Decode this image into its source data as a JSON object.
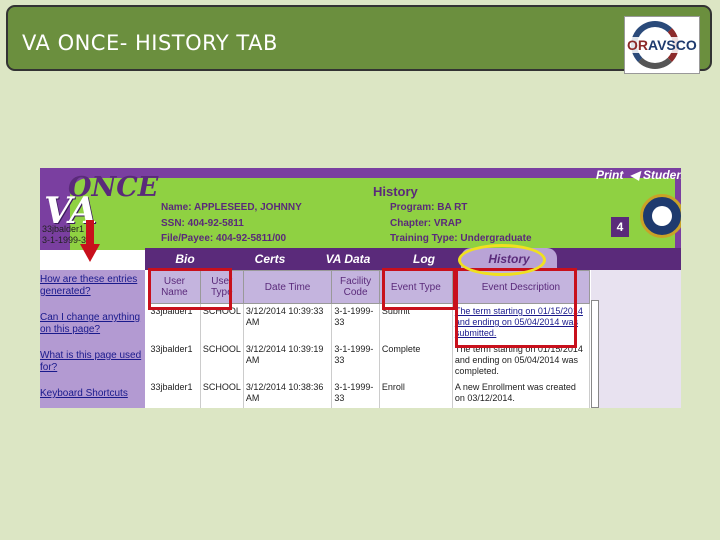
{
  "slide": {
    "title": "VA ONCE- HISTORY TAB"
  },
  "logo": {
    "or": "OR",
    "rest": "AVSCO"
  },
  "app": {
    "logo_once": "ONCE",
    "logo_va": "VA",
    "topnav": [
      "Print",
      "Studen"
    ],
    "page_title": "History",
    "name": "Name: APPLESEED, JOHNNY",
    "ssn": "SSN: 404-92-5811",
    "file": "File/Payee: 404-92-5811/00",
    "program": "Program: BA RT",
    "chapter": "Chapter: VRAP",
    "training": "Training Type: Undergraduate",
    "badge": "4",
    "user_lines": [
      "33jbalder1",
      "3-1-1999-3"
    ]
  },
  "tabs": [
    "Bio",
    "Certs",
    "VA Data",
    "Log",
    "History"
  ],
  "sidebar": {
    "links": [
      "How are these entries generated?",
      "Can I change anything on this page?",
      "What is this page used for?",
      "Keyboard Shortcuts"
    ]
  },
  "table": {
    "headers": [
      "User Name",
      "User Type",
      "Date Time",
      "Facility Code",
      "Event Type",
      "Event Description"
    ],
    "rows": [
      [
        "33jbalder1",
        "SCHOOL",
        "3/12/2014 10:39:33 AM",
        "3-1-1999-33",
        "Submit",
        "The term starting on 01/15/2014 and ending on 05/04/2014 was submitted."
      ],
      [
        "33jbalder1",
        "SCHOOL",
        "3/12/2014 10:39:19 AM",
        "3-1-1999-33",
        "Complete",
        "The term starting on 01/15/2014 and ending on 05/04/2014 was completed."
      ],
      [
        "33jbalder1",
        "SCHOOL",
        "3/12/2014 10:38:36 AM",
        "3-1-1999-33",
        "Enroll",
        "A new Enrollment was created on 03/12/2014."
      ]
    ]
  },
  "colors": {
    "purple": "#5a2a7a",
    "green": "#8fd142",
    "highlight_red": "#c8101c",
    "highlight_yellow": "#f0e020"
  }
}
